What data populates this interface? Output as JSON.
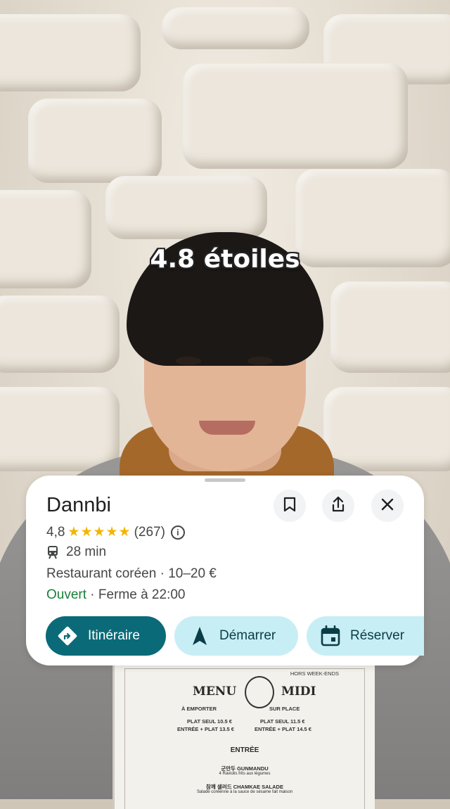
{
  "caption": "4.8 étoiles",
  "place": {
    "name": "Dannbi",
    "rating": "4,8",
    "stars": "★★★★★",
    "reviews": "(267)",
    "transit_time": "28 min",
    "category": "Restaurant coréen · 10–20 €",
    "status_open": "Ouvert",
    "status_hours": " · Ferme à 22:00"
  },
  "icons": {
    "save": "bookmark-icon",
    "share": "share-icon",
    "close": "close-icon",
    "transit": "train-icon",
    "info": "info-icon"
  },
  "actions": {
    "directions": "Itinéraire",
    "start": "Démarrer",
    "reserve": "Réserver"
  },
  "menu": {
    "left_title": "MENU",
    "right_title": "MIDI",
    "hors": "HORS WEEK-ENDS",
    "emporter": "À EMPORTER",
    "sur_place": "SUR PLACE",
    "plat_seul_emporter": "PLAT SEUL   10.5 €",
    "entree_plat_emporter": "ENTRÉE + PLAT   13.5 €",
    "plat_seul_place": "PLAT SEUL   11.5 €",
    "entree_plat_place": "ENTRÉE + PLAT   14.5 €",
    "entree": "ENTRÉE",
    "item1": "군만두 GUNMANDU",
    "item1_desc": "4 Raviolis frits aux légumes",
    "item2": "참깨 샐러드 CHAMKAE SALADE",
    "item2_desc": "Salade coréenne à la sauce de sésame fait maison"
  },
  "colors": {
    "primary": "#0b6a78",
    "secondary_bg": "#c8eef5",
    "star": "#f4b400",
    "open": "#188038"
  }
}
